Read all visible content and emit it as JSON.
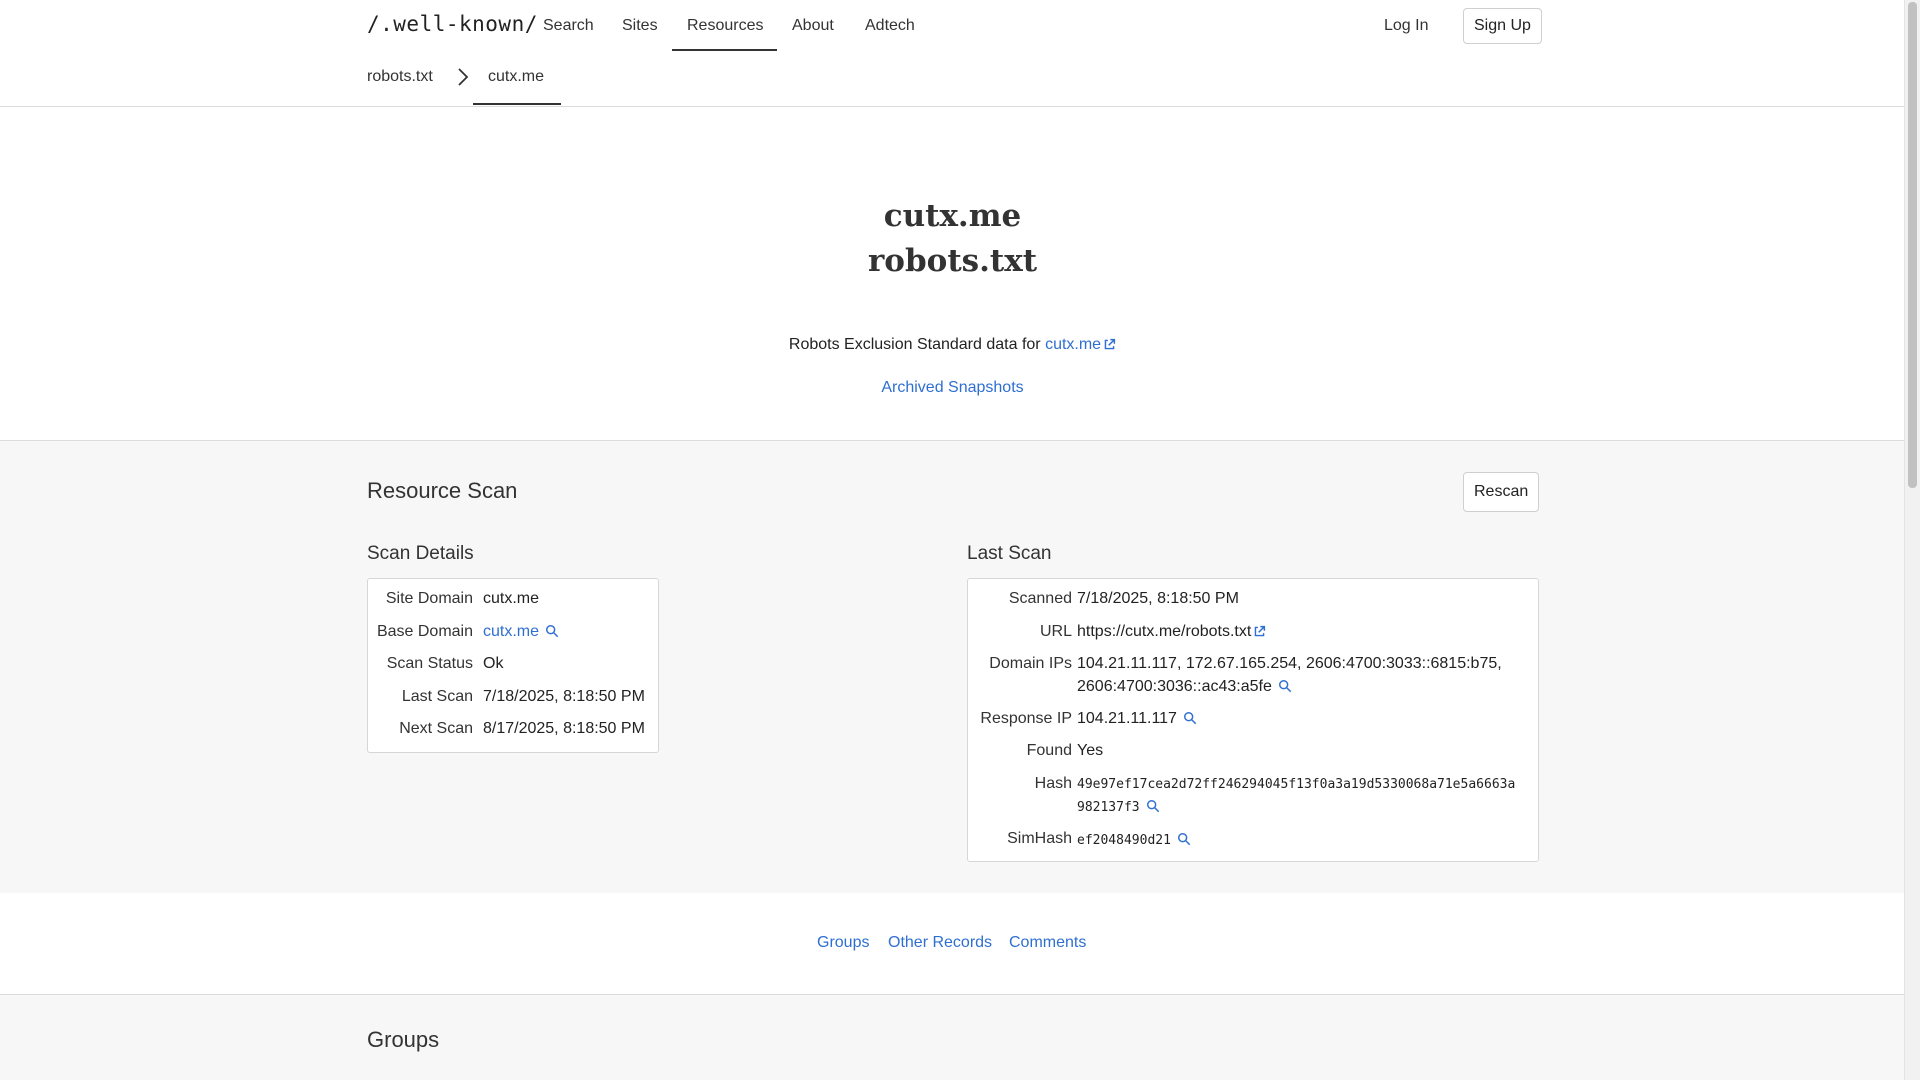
{
  "header": {
    "logo": "/.well-known/",
    "nav": [
      "Search",
      "Sites",
      "Resources",
      "About",
      "Adtech"
    ],
    "login": "Log In",
    "signup": "Sign Up",
    "breadcrumb": [
      "robots.txt",
      "cutx.me"
    ]
  },
  "hero": {
    "domain": "cutx.me",
    "resource": "robots.txt",
    "desc_prefix": "Robots Exclusion Standard data for",
    "desc_link": "cutx.me",
    "archived": "Archived Snapshots"
  },
  "scan": {
    "title": "Resource Scan",
    "rescan": "Rescan",
    "details_title": "Scan Details",
    "details": [
      {
        "label": "Site Domain",
        "value": "cutx.me"
      },
      {
        "label": "Base Domain",
        "value": "cutx.me"
      },
      {
        "label": "Scan Status",
        "value": "Ok"
      },
      {
        "label": "Last Scan",
        "value": "7/18/2025, 8:18:50 PM"
      },
      {
        "label": "Next Scan",
        "value": "8/17/2025, 8:18:50 PM"
      }
    ],
    "last_title": "Last Scan",
    "last": {
      "scanned_label": "Scanned",
      "scanned": "7/18/2025, 8:18:50 PM",
      "url_label": "URL",
      "url": "https://cutx.me/robots.txt",
      "ips_label": "Domain IPs",
      "ips_line1": "104.21.11.117, 172.67.165.254, 2606:4700:3033::6815:b75,",
      "ips_line2": "2606:4700:3036::ac43:a5fe",
      "resp_label": "Response IP",
      "resp": "104.21.11.117",
      "found_label": "Found",
      "found": "Yes",
      "hash_label": "Hash",
      "hash_line1": "49e97ef17cea2d72ff246294045f13f0a3a19d5330068a71e5a6663a",
      "hash_line2": "982137f3",
      "simhash_label": "SimHash",
      "simhash": "ef2048490d21"
    }
  },
  "tabs": [
    "Groups",
    "Other Records",
    "Comments"
  ],
  "groups_title": "Groups",
  "colors": {
    "link": "#2f6fd1",
    "grey_bg": "#f7f7f7",
    "border": "#dcdcdc"
  }
}
